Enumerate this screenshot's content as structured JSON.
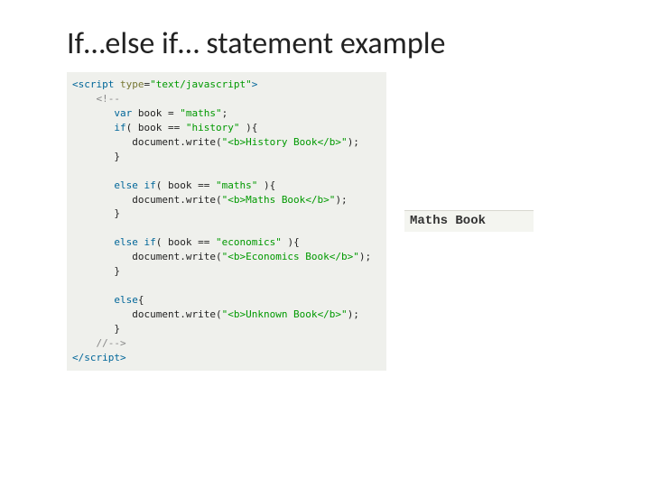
{
  "title": "If…else if… statement example",
  "code": {
    "lang_attr": "type",
    "lang_val": "\"text/javascript\"",
    "var_name": "book",
    "var_val": "\"maths\"",
    "branches": [
      {
        "cond_val": "\"history\"",
        "out_label": "History Book"
      },
      {
        "cond_val": "\"maths\"",
        "out_label": "Maths Book"
      },
      {
        "cond_val": "\"economics\"",
        "out_label": "Economics Book"
      }
    ],
    "else_label": "Unknown Book"
  },
  "output": "Maths Book"
}
